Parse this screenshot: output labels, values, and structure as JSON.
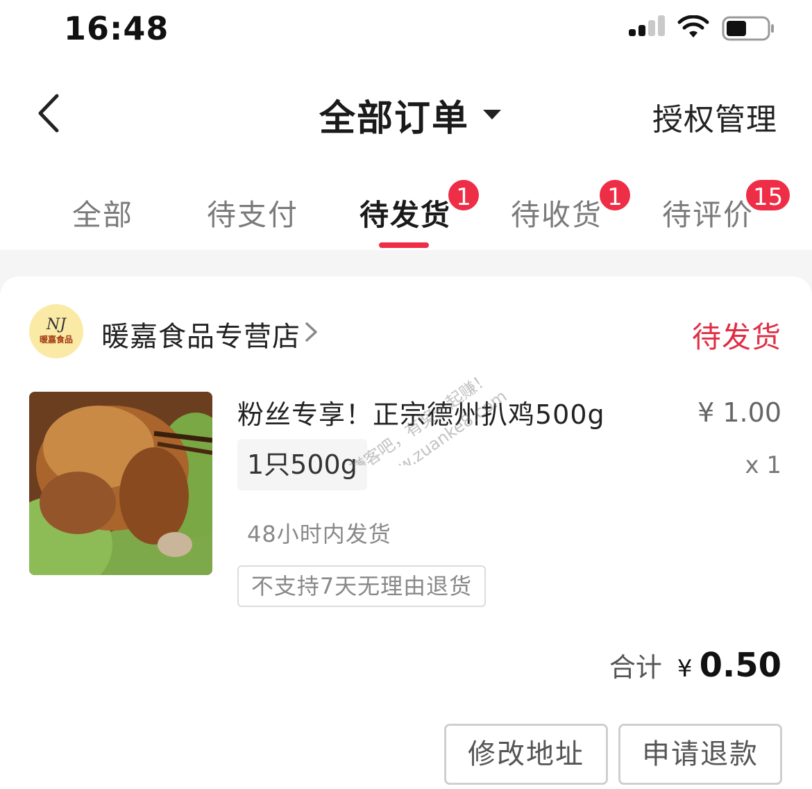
{
  "status_bar": {
    "time": "16:48",
    "battery_level": 0.5
  },
  "nav": {
    "title": "全部订单",
    "right_action": "授权管理"
  },
  "tabs": [
    {
      "label": "全部",
      "badge": null
    },
    {
      "label": "待支付",
      "badge": null
    },
    {
      "label": "待发货",
      "badge": "1",
      "active": true
    },
    {
      "label": "待收货",
      "badge": "1"
    },
    {
      "label": "待评价",
      "badge": "15"
    }
  ],
  "order": {
    "shop_name": "暖嘉食品专营店",
    "shop_logo_text": "暖嘉食品",
    "shop_logo_mark": "NJ",
    "status": "待发货",
    "product": {
      "name": "粉丝专享！正宗德州扒鸡500g",
      "price": "¥ 1.00",
      "spec": "1只500g",
      "quantity": "x 1",
      "shipping_note": "48小时内发货",
      "return_policy": "不支持7天无理由退货"
    },
    "total_label": "合计",
    "total_currency": "¥",
    "total_amount": "0.50",
    "actions": [
      "修改地址",
      "申请退款"
    ]
  },
  "watermark": {
    "line1": "赚客吧，有奖一起赚！",
    "line2": "www.zuanke8.com"
  },
  "colors": {
    "accent": "#ee2d47",
    "status_text": "#e02e45"
  }
}
